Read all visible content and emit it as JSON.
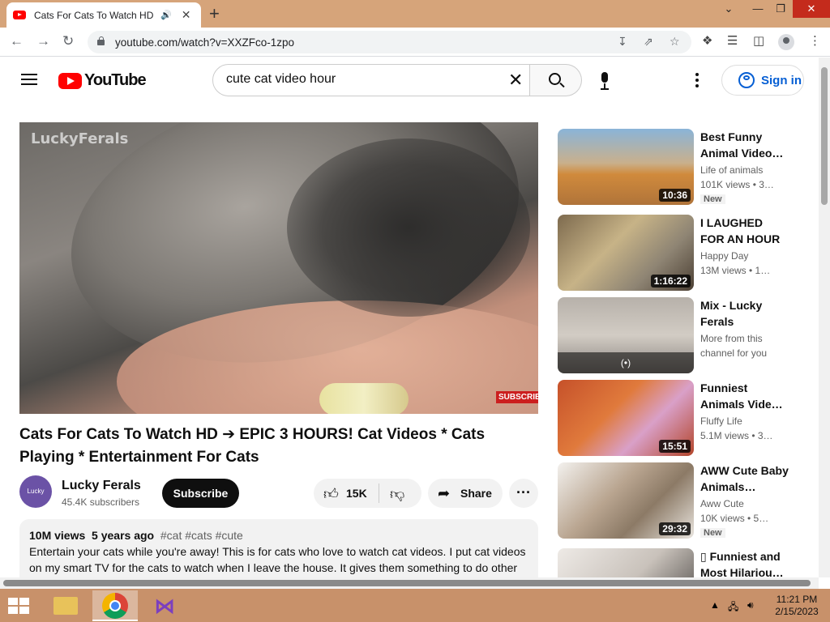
{
  "browser": {
    "tab_title": "Cats For Cats To Watch HD - ",
    "url": "youtube.com/watch?v=XXZFco-1zpo"
  },
  "youtube": {
    "logo_text": "YouTube",
    "search_value": "cute cat video hour",
    "sign_in": "Sign in"
  },
  "player": {
    "watermark": "LuckyFerals",
    "subscribe_badge": "SUBSCRIBE"
  },
  "video": {
    "title": "Cats For Cats To Watch HD ➔ EPIC 3 HOURS! Cat Videos * Cats Playing * Entertainment For Cats",
    "channel": "Lucky Ferals",
    "channel_avatar_text": "Lucky Ferals",
    "subscribers": "45.4K subscribers",
    "subscribe_label": "Subscribe",
    "likes": "15K",
    "share_label": "Share",
    "views": "10M views",
    "age": "5 years ago",
    "tags": "#cat #cats #cute",
    "description": "Entertain your cats while you're away! This is for cats who love to watch cat videos. I put cat videos on my smart TV for the cats to watch when I leave the house. It gives them something to do other"
  },
  "related": [
    {
      "title": "Best Funny Animal Video…",
      "channel": "Life of animals",
      "views": "101K views • 3…",
      "duration": "10:36",
      "badge": "New"
    },
    {
      "title": "I LAUGHED FOR AN HOUR😹…",
      "channel": "Happy Day",
      "views": "13M views • 1…",
      "duration": "1:16:22",
      "badge": ""
    },
    {
      "title": "Mix - Lucky Ferals",
      "channel": "More from this",
      "views": "channel for you",
      "duration": "",
      "badge": "",
      "mix": "(•)"
    },
    {
      "title": "Funniest Animals Vide…",
      "channel": "Fluffy Life",
      "views": "5.1M views • 3…",
      "duration": "15:51",
      "badge": ""
    },
    {
      "title": "AWW Cute Baby Animals…",
      "channel": "Aww Cute",
      "views": "10K views • 5…",
      "duration": "29:32",
      "badge": "New"
    },
    {
      "title": "▯ Funniest and Most Hilariou…",
      "channel": "",
      "views": "",
      "duration": "",
      "badge": ""
    }
  ],
  "taskbar": {
    "time": "11:21 PM",
    "date": "2/15/2023"
  }
}
